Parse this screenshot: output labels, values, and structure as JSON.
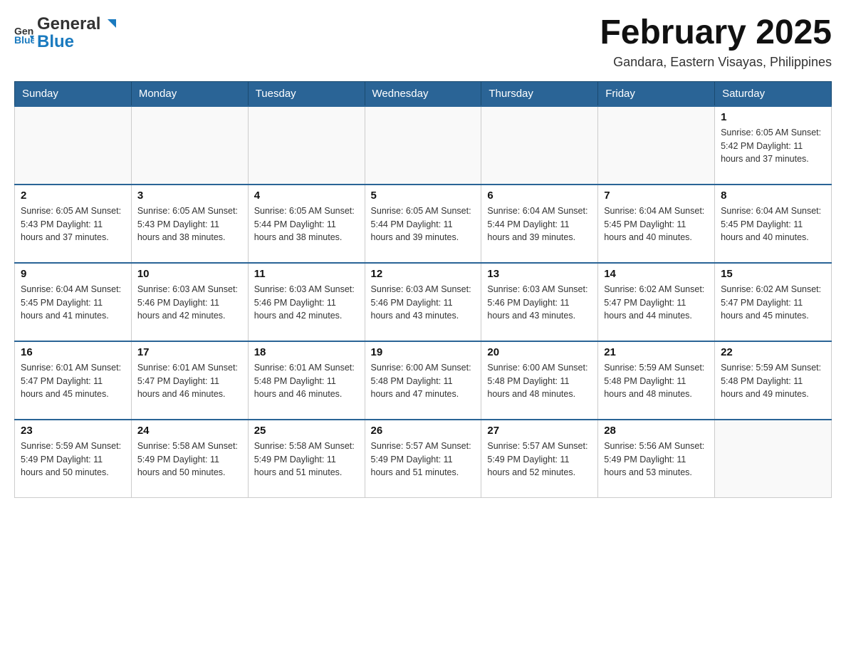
{
  "header": {
    "logo": {
      "general": "General",
      "blue": "Blue"
    },
    "title": "February 2025",
    "subtitle": "Gandara, Eastern Visayas, Philippines"
  },
  "days_of_week": [
    "Sunday",
    "Monday",
    "Tuesday",
    "Wednesday",
    "Thursday",
    "Friday",
    "Saturday"
  ],
  "weeks": [
    {
      "days": [
        {
          "num": "",
          "info": ""
        },
        {
          "num": "",
          "info": ""
        },
        {
          "num": "",
          "info": ""
        },
        {
          "num": "",
          "info": ""
        },
        {
          "num": "",
          "info": ""
        },
        {
          "num": "",
          "info": ""
        },
        {
          "num": "1",
          "info": "Sunrise: 6:05 AM\nSunset: 5:42 PM\nDaylight: 11 hours and 37 minutes."
        }
      ]
    },
    {
      "days": [
        {
          "num": "2",
          "info": "Sunrise: 6:05 AM\nSunset: 5:43 PM\nDaylight: 11 hours and 37 minutes."
        },
        {
          "num": "3",
          "info": "Sunrise: 6:05 AM\nSunset: 5:43 PM\nDaylight: 11 hours and 38 minutes."
        },
        {
          "num": "4",
          "info": "Sunrise: 6:05 AM\nSunset: 5:44 PM\nDaylight: 11 hours and 38 minutes."
        },
        {
          "num": "5",
          "info": "Sunrise: 6:05 AM\nSunset: 5:44 PM\nDaylight: 11 hours and 39 minutes."
        },
        {
          "num": "6",
          "info": "Sunrise: 6:04 AM\nSunset: 5:44 PM\nDaylight: 11 hours and 39 minutes."
        },
        {
          "num": "7",
          "info": "Sunrise: 6:04 AM\nSunset: 5:45 PM\nDaylight: 11 hours and 40 minutes."
        },
        {
          "num": "8",
          "info": "Sunrise: 6:04 AM\nSunset: 5:45 PM\nDaylight: 11 hours and 40 minutes."
        }
      ]
    },
    {
      "days": [
        {
          "num": "9",
          "info": "Sunrise: 6:04 AM\nSunset: 5:45 PM\nDaylight: 11 hours and 41 minutes."
        },
        {
          "num": "10",
          "info": "Sunrise: 6:03 AM\nSunset: 5:46 PM\nDaylight: 11 hours and 42 minutes."
        },
        {
          "num": "11",
          "info": "Sunrise: 6:03 AM\nSunset: 5:46 PM\nDaylight: 11 hours and 42 minutes."
        },
        {
          "num": "12",
          "info": "Sunrise: 6:03 AM\nSunset: 5:46 PM\nDaylight: 11 hours and 43 minutes."
        },
        {
          "num": "13",
          "info": "Sunrise: 6:03 AM\nSunset: 5:46 PM\nDaylight: 11 hours and 43 minutes."
        },
        {
          "num": "14",
          "info": "Sunrise: 6:02 AM\nSunset: 5:47 PM\nDaylight: 11 hours and 44 minutes."
        },
        {
          "num": "15",
          "info": "Sunrise: 6:02 AM\nSunset: 5:47 PM\nDaylight: 11 hours and 45 minutes."
        }
      ]
    },
    {
      "days": [
        {
          "num": "16",
          "info": "Sunrise: 6:01 AM\nSunset: 5:47 PM\nDaylight: 11 hours and 45 minutes."
        },
        {
          "num": "17",
          "info": "Sunrise: 6:01 AM\nSunset: 5:47 PM\nDaylight: 11 hours and 46 minutes."
        },
        {
          "num": "18",
          "info": "Sunrise: 6:01 AM\nSunset: 5:48 PM\nDaylight: 11 hours and 46 minutes."
        },
        {
          "num": "19",
          "info": "Sunrise: 6:00 AM\nSunset: 5:48 PM\nDaylight: 11 hours and 47 minutes."
        },
        {
          "num": "20",
          "info": "Sunrise: 6:00 AM\nSunset: 5:48 PM\nDaylight: 11 hours and 48 minutes."
        },
        {
          "num": "21",
          "info": "Sunrise: 5:59 AM\nSunset: 5:48 PM\nDaylight: 11 hours and 48 minutes."
        },
        {
          "num": "22",
          "info": "Sunrise: 5:59 AM\nSunset: 5:48 PM\nDaylight: 11 hours and 49 minutes."
        }
      ]
    },
    {
      "days": [
        {
          "num": "23",
          "info": "Sunrise: 5:59 AM\nSunset: 5:49 PM\nDaylight: 11 hours and 50 minutes."
        },
        {
          "num": "24",
          "info": "Sunrise: 5:58 AM\nSunset: 5:49 PM\nDaylight: 11 hours and 50 minutes."
        },
        {
          "num": "25",
          "info": "Sunrise: 5:58 AM\nSunset: 5:49 PM\nDaylight: 11 hours and 51 minutes."
        },
        {
          "num": "26",
          "info": "Sunrise: 5:57 AM\nSunset: 5:49 PM\nDaylight: 11 hours and 51 minutes."
        },
        {
          "num": "27",
          "info": "Sunrise: 5:57 AM\nSunset: 5:49 PM\nDaylight: 11 hours and 52 minutes."
        },
        {
          "num": "28",
          "info": "Sunrise: 5:56 AM\nSunset: 5:49 PM\nDaylight: 11 hours and 53 minutes."
        },
        {
          "num": "",
          "info": ""
        }
      ]
    }
  ]
}
